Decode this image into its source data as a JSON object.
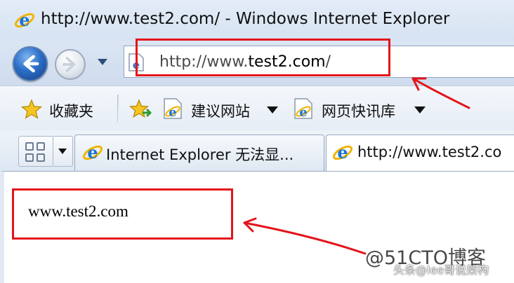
{
  "window": {
    "title": "http://www.test2.com/ - Windows Internet Explorer",
    "icon": "ie-logo-icon"
  },
  "nav": {
    "back_icon": "back-arrow-icon",
    "forward_icon": "forward-arrow-icon",
    "history_dropdown_icon": "chevron-down-icon"
  },
  "address": {
    "prefix": "http://www.",
    "host": "test2.com",
    "suffix": "/"
  },
  "favorites": {
    "label": "收藏夹",
    "links": [
      {
        "label": "建议网站"
      },
      {
        "label": "网页快讯库"
      }
    ]
  },
  "tabs": [
    {
      "label": "Internet Explorer 无法显...",
      "active": false
    },
    {
      "label": "http://www.test2.co",
      "active": true
    }
  ],
  "content": {
    "text": "www.test2.com"
  },
  "watermark": {
    "main": "@51CTO博客",
    "sub": "头条@lee哥说架构"
  },
  "colors": {
    "annotation_red": "#e3141b",
    "ie_blue": "#2c6fc8"
  }
}
